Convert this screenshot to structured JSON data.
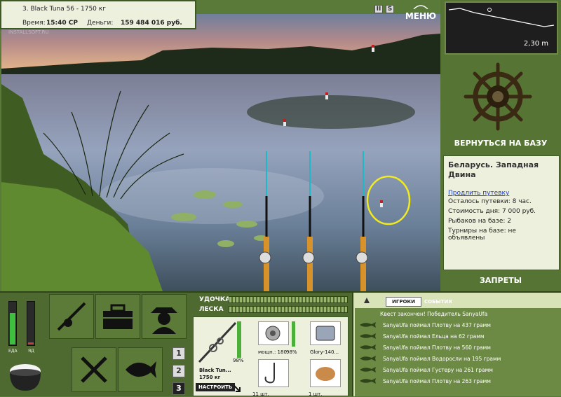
{
  "info": {
    "rank_title": "3. Black Tuna 56 - 1750 кг",
    "time_label": "Время:",
    "time_value": "15:40 СР",
    "money_label": "Деньги:",
    "money_value": "159 484 016 руб.",
    "watermark": "INSTALLSOFT.RU"
  },
  "top": {
    "pause_label": "II",
    "sound_label": "S",
    "menu_label": "МЕНЮ"
  },
  "minimap": {
    "depth": "2,30 m"
  },
  "base": {
    "return_label": "ВЕРНУТЬСЯ НА БАЗУ",
    "location": "Беларусь. Западная Двина",
    "extend_link": "Продлить путевку",
    "stats": [
      "Осталось путевки: 8 час.",
      "Стоимость дня: 7 000 руб.",
      "Рыбаков на базе: 2",
      "Турниры на базе: не объявлены"
    ],
    "bans_label": "ЗАПРЕТЫ"
  },
  "meters": {
    "food_label": "ЕДА",
    "poison_label": "ЯД",
    "food_level": 0.72,
    "poison_level": 0.05
  },
  "pages": [
    "1",
    "2",
    "3"
  ],
  "bars": {
    "rod_label": "УДОЧКА",
    "line_label": "ЛЕСКА"
  },
  "tackle": {
    "rod_name": "Black Tun...",
    "rod_weight": "1750 кг",
    "rod_pct": "98%",
    "reel_caption": "мощн.: 180",
    "reel_pct": "98%",
    "line_caption": "Glory-140...",
    "hooks_caption": "11 шт.",
    "bait_caption": "1 шт.",
    "setup_label": "НАСТРОИТЬ"
  },
  "chat": {
    "tab_players": "ИГРОКИ",
    "tab_events": "СОБЫТИЯ",
    "messages": [
      "Квест закончен! Победитель SanyaUfa",
      "SanyaUfa поймал Плотву на 437 грамм",
      "SanyaUfa поймал Ельца на 62 грамм",
      "SanyaUfa поймал Плотву на 560 грамм",
      "SanyaUfa поймал Водоросли на 195 грамм",
      "SanyaUfa поймал Густеру на 261 грамм",
      "SanyaUfa поймал Плотву на 263 грамм"
    ]
  }
}
